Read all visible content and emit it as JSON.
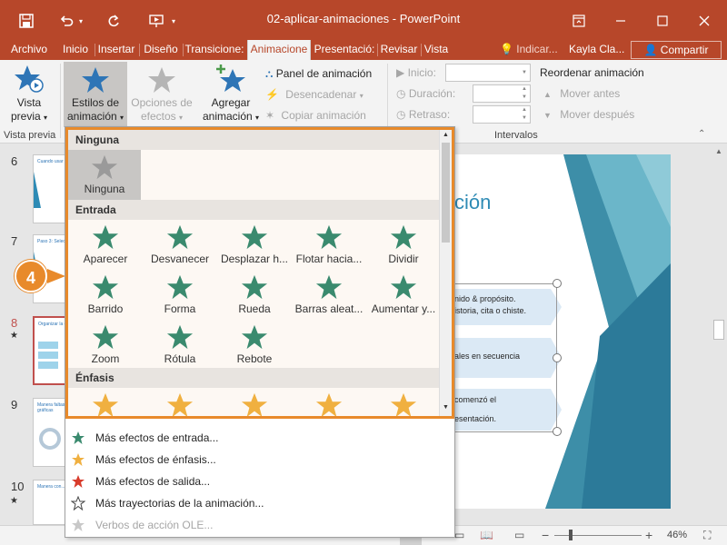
{
  "window": {
    "title": "02-aplicar-animaciones  -  PowerPoint",
    "user": "Kayla Cla...",
    "share_label": "Compartir",
    "tell_me": "Indicar..."
  },
  "tabs": [
    "Archivo",
    "Inicio",
    "Insertar",
    "Diseño",
    "Transicione:",
    "Animacione",
    "Presentació:",
    "Revisar",
    "Vista"
  ],
  "active_tab": "Animacione",
  "ribbon": {
    "preview": {
      "line1": "Vista",
      "line2": "previa",
      "group": "Vista previa"
    },
    "styles": {
      "line1": "Estilos de",
      "line2": "animación"
    },
    "options": {
      "line1": "Opciones de",
      "line2": "efectos"
    },
    "add": {
      "line1": "Agregar",
      "line2": "animación"
    },
    "panel": "Panel de animación",
    "trigger": "Desencadenar",
    "painter": "Copiar animación",
    "start_label": "Inicio:",
    "duration_label": "Duración:",
    "delay_label": "Retraso:",
    "reorder_title": "Reordenar animación",
    "move_earlier": "Mover antes",
    "move_later": "Mover después",
    "intervals_group": "Intervalos"
  },
  "thumbnails": [
    {
      "num": "6",
      "title": "Cuando usar P..."
    },
    {
      "num": "7",
      "title": "Paso 3: Selecc..."
    },
    {
      "num": "8",
      "title": "Organizar la gr..."
    },
    {
      "num": "9",
      "title": "Manera faltas ambient... gráficas"
    },
    {
      "num": "10",
      "title": "Manera con..."
    }
  ],
  "selected_slide": "8",
  "slide": {
    "title_fragment": "ción",
    "row1a": "nido & propósito.",
    "row1b": "istoria, cita o chiste.",
    "row2": "ales en secuencia",
    "row3a": "comenzó el",
    "row3b": "esentación."
  },
  "callout": "4",
  "gallery": {
    "sections": {
      "none": "Ninguna",
      "entrance": "Entrada",
      "emphasis": "Énfasis"
    },
    "none_item": "Ninguna",
    "entrance": [
      "Aparecer",
      "Desvanecer",
      "Desplazar h...",
      "Flotar hacia...",
      "Dividir",
      "Barrido",
      "Forma",
      "Rueda",
      "Barras aleat...",
      "Aumentar y...",
      "Zoom",
      "Rótula",
      "Rebote"
    ]
  },
  "menu": [
    {
      "label": "Más efectos de entrada...",
      "color": "#3a8a6e",
      "enabled": true
    },
    {
      "label": "Más efectos de énfasis...",
      "color": "#f0b040",
      "enabled": true
    },
    {
      "label": "Más efectos de salida...",
      "color": "#d83b2b",
      "enabled": true
    },
    {
      "label": "Más trayectorias de la animación...",
      "color": "#ffffff",
      "enabled": true
    },
    {
      "label": "Verbos de acción OLE...",
      "color": "#b0b0b0",
      "enabled": false
    }
  ],
  "status": {
    "zoom": "46%"
  },
  "colors": {
    "brand": "#b7472a",
    "highlight": "#e88a2b",
    "entrance_star": "#3a8a6e",
    "emphasis_star": "#f0b040"
  }
}
